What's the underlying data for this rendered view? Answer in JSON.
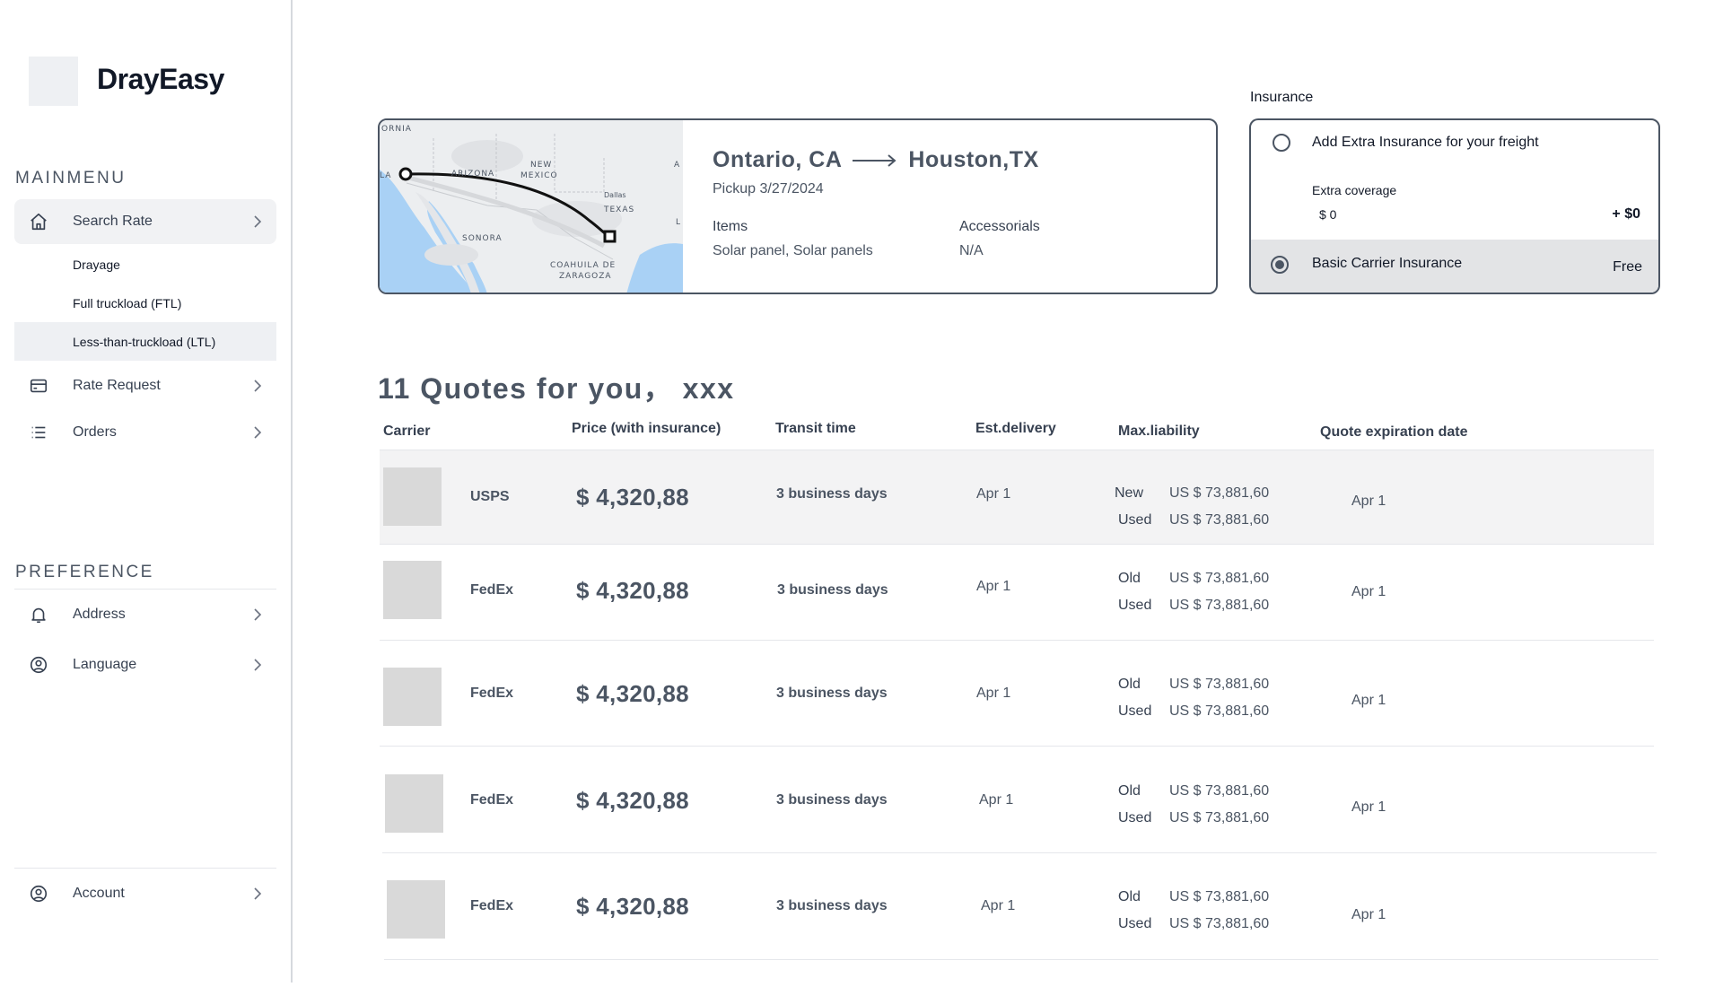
{
  "app": {
    "name": "DrayEasy"
  },
  "sidebar": {
    "main_menu_title": "MAINMENU",
    "search_rate": "Search Rate",
    "sub_items": [
      "Drayage",
      "Full truckload (FTL)",
      "Less-than-truckload (LTL)"
    ],
    "rate_request": "Rate Request",
    "orders": "Orders",
    "preference_title": "PREFERENCE",
    "address": "Address",
    "language": "Language",
    "account": "Account"
  },
  "route": {
    "origin": "Ontario, CA",
    "destination": "Houston,TX",
    "pickup": "Pickup 3/27/2024",
    "items_label": "Items",
    "items_value": "Solar panel, Solar panels",
    "accessorials_label": "Accessorials",
    "accessorials_value": "N/A"
  },
  "map_labels": {
    "california": "ORNIA",
    "arizona": "ARIZONA",
    "new_mexico_1": "NEW",
    "new_mexico_2": "MEXICO",
    "dallas": "Dallas",
    "texas": "TEXAS",
    "sonora": "SONORA",
    "coahuila_1": "COAHUILA DE",
    "coahuila_2": "ZARAGOZA",
    "edge_a": "A",
    "edge_l": "L",
    "edge_la": "LA"
  },
  "insurance": {
    "title": "Insurance",
    "extra_label": "Add Extra Insurance for your freight",
    "extra_coverage_label": "Extra coverage",
    "extra_coverage_value": "$ 0",
    "extra_price": "+ $0",
    "basic_label": "Basic Carrier Insurance",
    "basic_price": "Free",
    "selected": "basic"
  },
  "quotes": {
    "title": "11 Quotes for you，  xxx",
    "columns": [
      "Carrier",
      "Price (with insurance)",
      "Transit time",
      "Est.delivery",
      "Max.liability",
      "Quote expiration date"
    ],
    "rows": [
      {
        "carrier": "USPS",
        "price": "$ 4,320,88",
        "transit": "3 business days",
        "delivery": "Apr 1",
        "liab1_label": "New",
        "liab1_value": "US $ 73,881,60",
        "liab2_label": "Used",
        "liab2_value": "US $ 73,881,60",
        "expiration": "Apr 1"
      },
      {
        "carrier": "FedEx",
        "price": "$ 4,320,88",
        "transit": "3 business days",
        "delivery": "Apr 1",
        "liab1_label": "Old",
        "liab1_value": "US $ 73,881,60",
        "liab2_label": "Used",
        "liab2_value": "US $ 73,881,60",
        "expiration": "Apr 1"
      },
      {
        "carrier": "FedEx",
        "price": "$ 4,320,88",
        "transit": "3 business days",
        "delivery": "Apr 1",
        "liab1_label": "Old",
        "liab1_value": "US $ 73,881,60",
        "liab2_label": "Used",
        "liab2_value": "US $ 73,881,60",
        "expiration": "Apr 1"
      },
      {
        "carrier": "FedEx",
        "price": "$ 4,320,88",
        "transit": "3 business days",
        "delivery": "Apr 1",
        "liab1_label": "Old",
        "liab1_value": "US $ 73,881,60",
        "liab2_label": "Used",
        "liab2_value": "US $ 73,881,60",
        "expiration": "Apr 1"
      },
      {
        "carrier": "FedEx",
        "price": "$ 4,320,88",
        "transit": "3 business days",
        "delivery": "Apr 1",
        "liab1_label": "Old",
        "liab1_value": "US $ 73,881,60",
        "liab2_label": "Used",
        "liab2_value": "US $ 73,881,60",
        "expiration": "Apr 1"
      }
    ]
  }
}
